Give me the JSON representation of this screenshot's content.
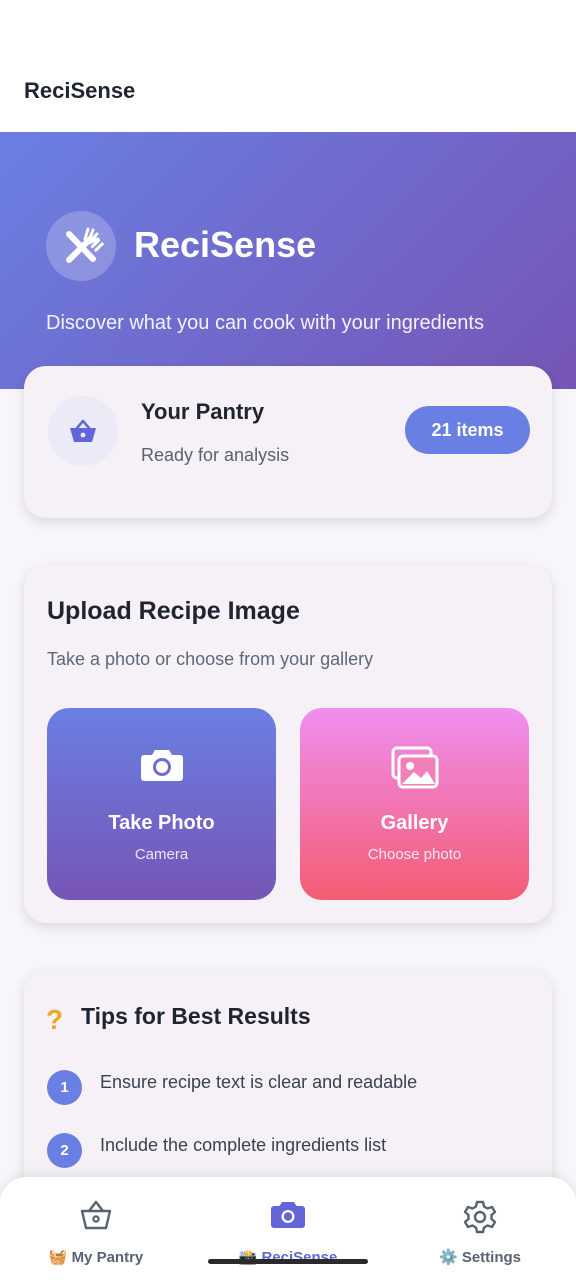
{
  "appbar": {
    "title": "ReciSense"
  },
  "hero": {
    "title": "ReciSense",
    "subtitle": "Discover what you can cook with your ingredients",
    "logo_icon": "fork-knife-icon"
  },
  "pantry": {
    "title": "Your Pantry",
    "status": "Ready for analysis",
    "badge": "21 items",
    "icon": "basket-icon"
  },
  "upload": {
    "title": "Upload Recipe Image",
    "subtitle": "Take a photo or choose from your gallery",
    "camera": {
      "label": "Take Photo",
      "sub": "Camera",
      "icon": "camera-icon"
    },
    "gallery": {
      "label": "Gallery",
      "sub": "Choose photo",
      "icon": "gallery-icon"
    }
  },
  "tips": {
    "icon_glyph": "?",
    "title": "Tips for Best Results",
    "items": [
      {
        "num": "1",
        "text": "Ensure recipe text is clear and readable"
      },
      {
        "num": "2",
        "text": "Include the complete ingredients list"
      }
    ]
  },
  "nav": {
    "items": [
      {
        "label": "🧺 My Pantry",
        "icon": "basket-icon"
      },
      {
        "label": "📸 ReciSense",
        "icon": "camera-icon"
      },
      {
        "label": "⚙️ Settings",
        "icon": "gear-icon"
      }
    ]
  },
  "colors": {
    "accent": "#6a7fe3",
    "accent_dark": "#7655b5",
    "gallery_top": "#ef8ff0",
    "gallery_bottom": "#f45c73",
    "tip_icon": "#f0a81e",
    "nav_active": "#6366d9"
  }
}
